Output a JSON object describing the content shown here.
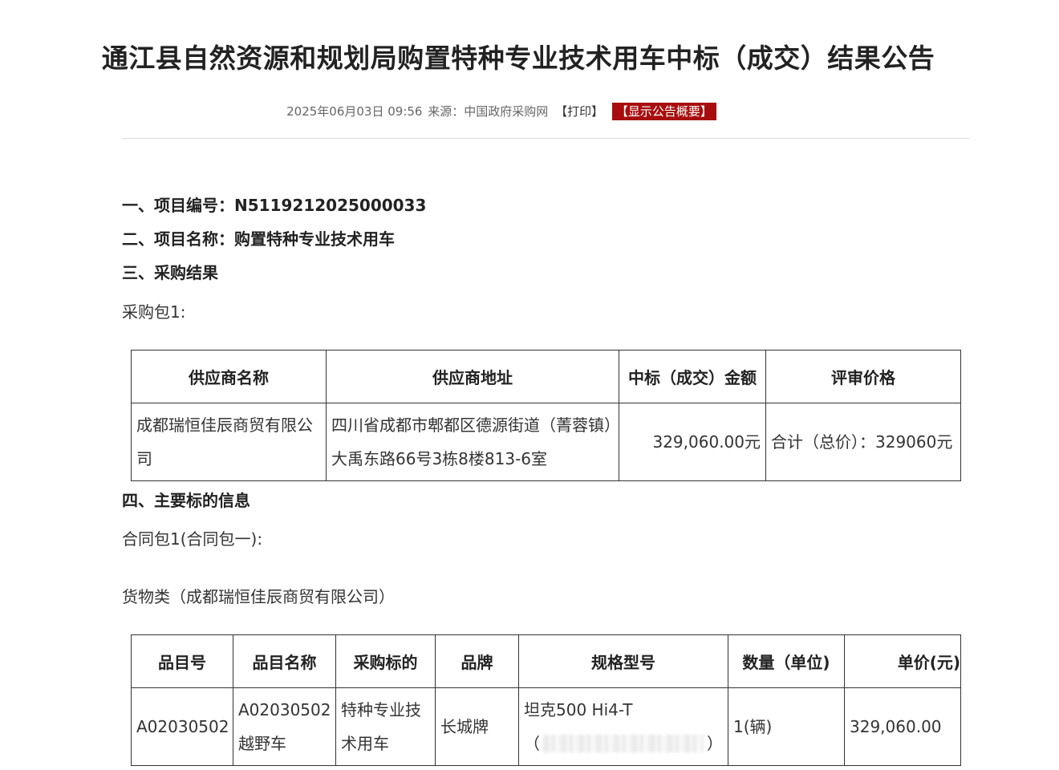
{
  "title": "通江县自然资源和规划局购置特种专业技术用车中标（成交）结果公告",
  "meta": {
    "datetime": "2025年06月03日 09:56",
    "source_label": "来源：",
    "source": "中国政府采购网",
    "print": "【打印】",
    "summary": "【显示公告概要】"
  },
  "sections": {
    "project_no": "一、项目编号：N5119212025000033",
    "project_name": "二、项目名称：购置特种专业技术用车",
    "result": "三、采购结果",
    "package": "采购包1:",
    "subject_info": "四、主要标的信息",
    "contract_package": "合同包1(合同包一):",
    "goods": "货物类（成都瑞恒佳辰商贸有限公司）"
  },
  "result_table": {
    "headers": [
      "供应商名称",
      "供应商地址",
      "中标（成交）金额",
      "评审价格"
    ],
    "row": {
      "supplier": "成都瑞恒佳辰商贸有限公司",
      "address": "四川省成都市郫都区德源街道（菁蓉镇）大禹东路66号3栋8楼813-6室",
      "amount": "329,060.00元",
      "review_price": "合计（总价）：329060元"
    }
  },
  "item_table": {
    "headers": [
      "品目号",
      "品目名称",
      "采购标的",
      "品牌",
      "规格型号",
      "数量（单位)",
      "单价(元)"
    ],
    "row": {
      "item_no": "A02030502",
      "item_name": "A02030502越野车",
      "subject": "特种专业技术用车",
      "brand": "长城牌",
      "model": "坦克500 Hi4-T",
      "model_paren_open": "（",
      "model_paren_close": "）",
      "quantity": "1(辆)",
      "unit_price": "329,060.00"
    }
  }
}
